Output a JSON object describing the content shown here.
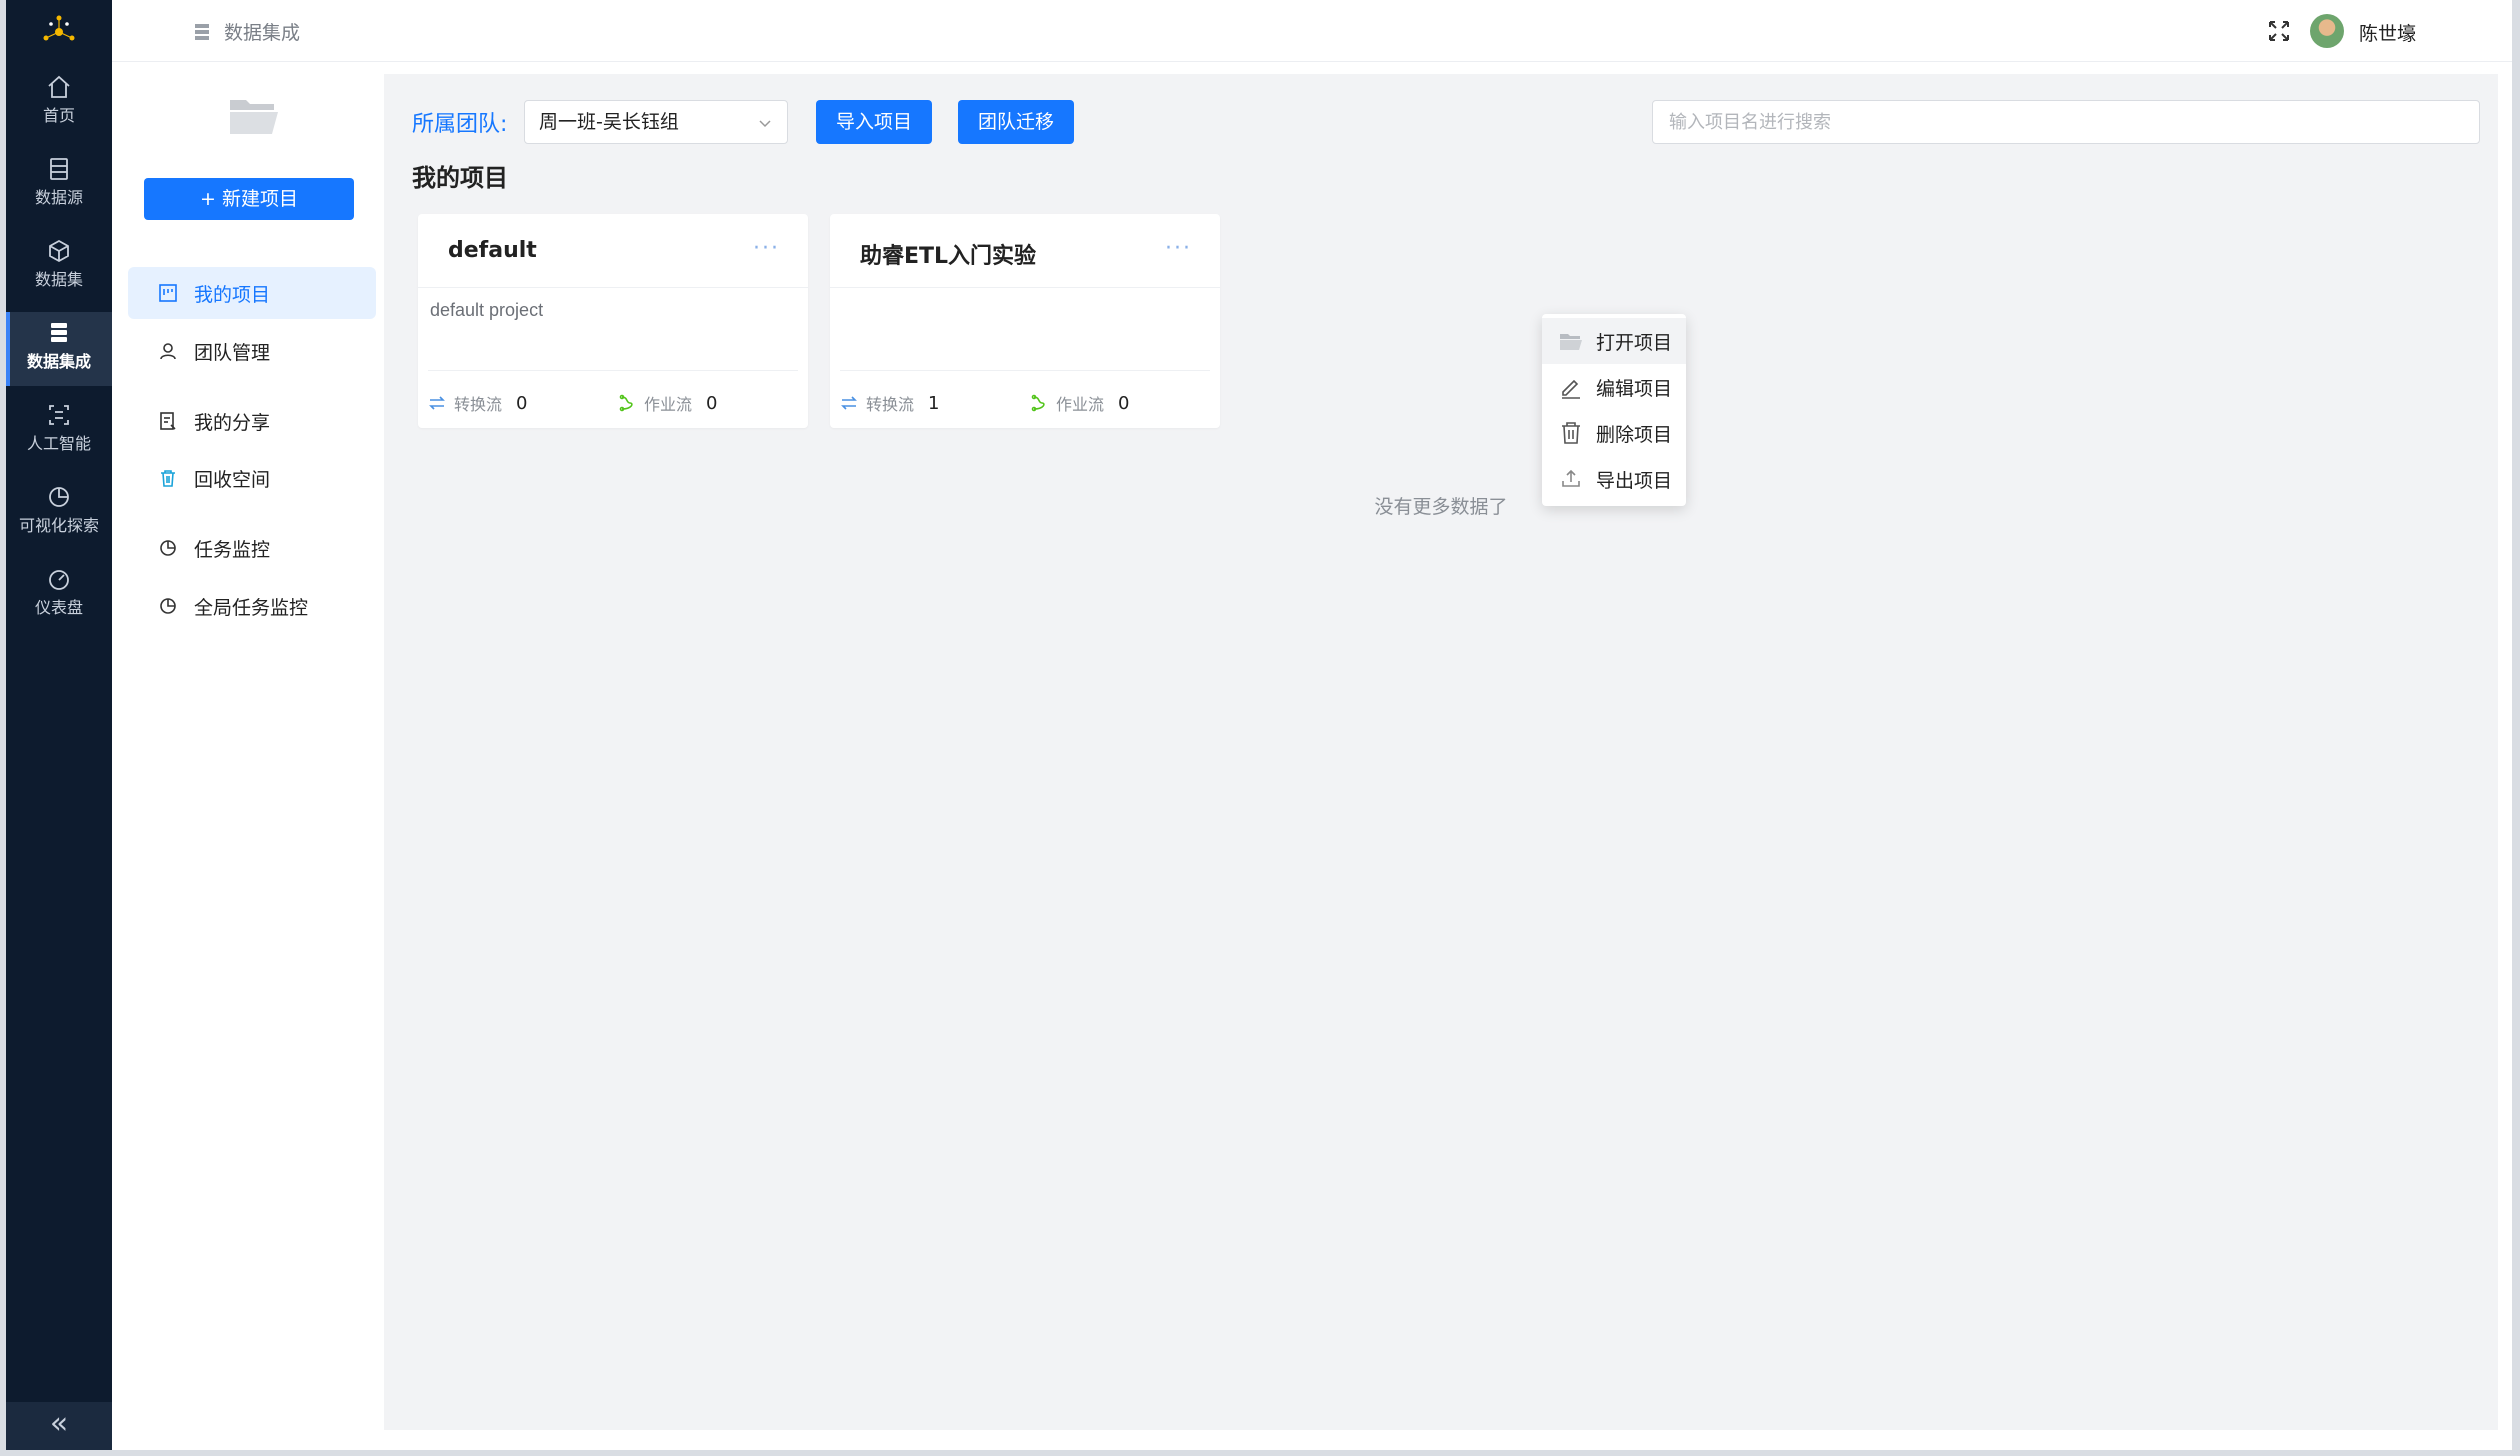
{
  "rail": {
    "items": [
      {
        "label": "首页",
        "icon": "home-icon"
      },
      {
        "label": "数据源",
        "icon": "datasource-icon"
      },
      {
        "label": "数据集",
        "icon": "dataset-cube-icon"
      },
      {
        "label": "数据集成",
        "icon": "integration-stack-icon",
        "active": true
      },
      {
        "label": "人工智能",
        "icon": "ai-scan-icon"
      },
      {
        "label": "可视化探索",
        "icon": "pie-chart-icon"
      },
      {
        "label": "仪表盘",
        "icon": "dashboard-gauge-icon"
      }
    ],
    "collapse_label": "«"
  },
  "topbar": {
    "breadcrumb": "数据集成",
    "user_name": "陈世壕"
  },
  "sidebar": {
    "new_project_label": "+ 新建项目",
    "menu": [
      {
        "label": "我的项目",
        "icon": "project-board-icon",
        "active": true
      },
      {
        "label": "团队管理",
        "icon": "user-icon"
      },
      {
        "label": "我的分享",
        "icon": "share-doc-icon"
      },
      {
        "label": "回收空间",
        "icon": "trash-icon"
      },
      {
        "label": "任务监控",
        "icon": "pie-monitor-icon"
      },
      {
        "label": "全局任务监控",
        "icon": "pie-monitor-icon"
      }
    ]
  },
  "toolbar": {
    "team_label": "所属团队:",
    "team_value": "周一班-吴长钰组",
    "import_label": "导入项目",
    "migrate_label": "团队迁移",
    "search_placeholder": "输入项目名进行搜索"
  },
  "section_title": "我的项目",
  "projects": [
    {
      "title": "default",
      "description": "default project",
      "transform_label": "转换流",
      "transform_count": "0",
      "job_label": "作业流",
      "job_count": "0",
      "more": "···"
    },
    {
      "title": "助睿ETL入门实验",
      "description": "",
      "transform_label": "转换流",
      "transform_count": "1",
      "job_label": "作业流",
      "job_count": "0",
      "more": "···"
    }
  ],
  "no_more": "没有更多数据了",
  "dropdown": {
    "items": [
      {
        "label": "打开项目",
        "icon": "open-folder-icon"
      },
      {
        "label": "编辑项目",
        "icon": "edit-pen-icon"
      },
      {
        "label": "删除项目",
        "icon": "trash-icon"
      },
      {
        "label": "导出项目",
        "icon": "export-upload-icon"
      }
    ]
  },
  "colors": {
    "rail_bg": "#0d1b2e",
    "accent": "#1677ff",
    "content_bg": "#f2f3f5"
  }
}
